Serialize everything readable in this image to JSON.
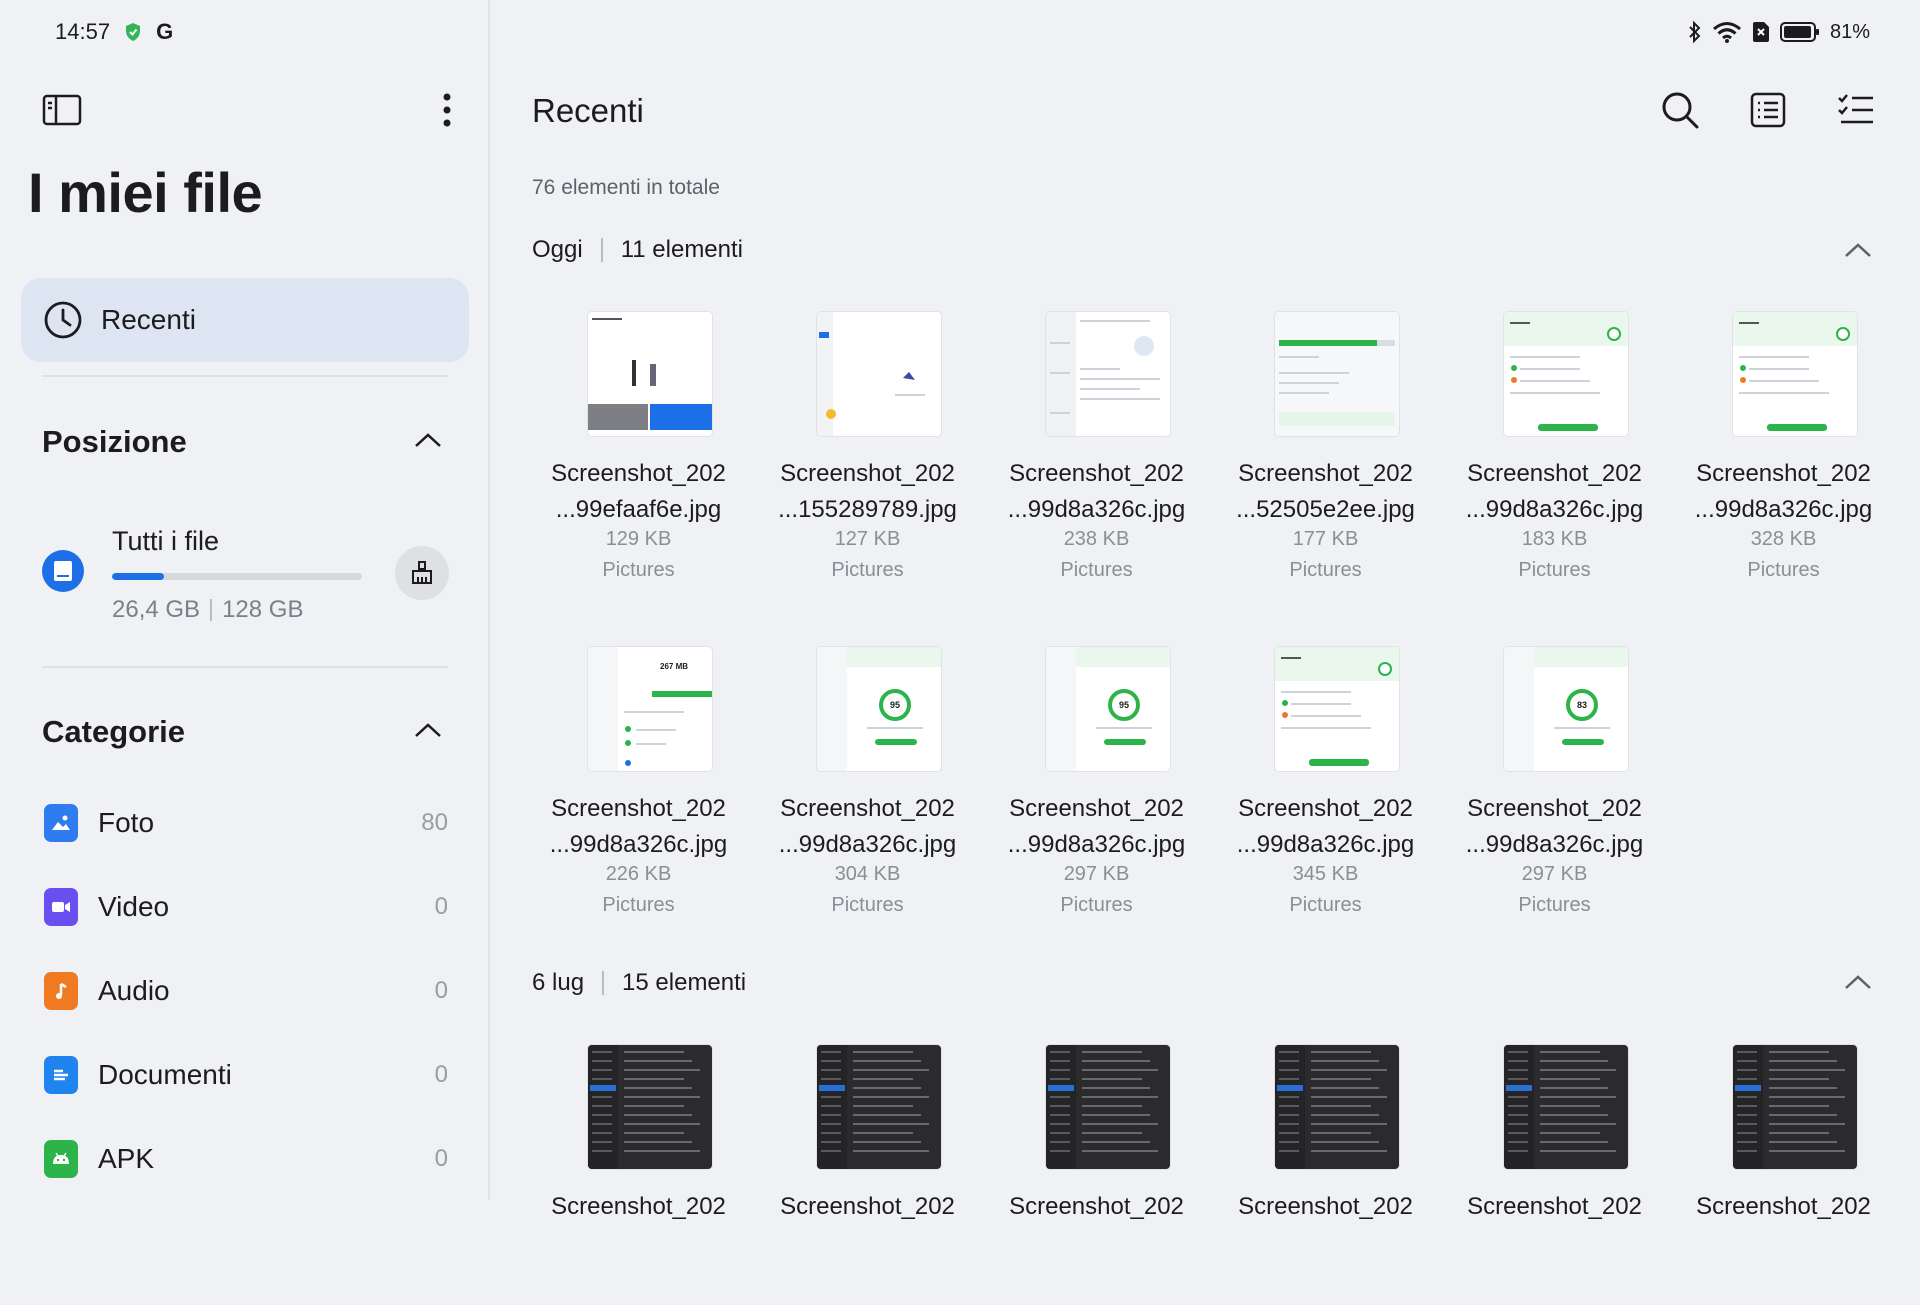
{
  "status_bar": {
    "time": "14:57",
    "left_icons": [
      "shield-icon",
      "google-icon"
    ],
    "battery_percent": "81%",
    "right_icons": [
      "bluetooth-icon",
      "wifi-icon",
      "no-sim-icon",
      "battery-icon"
    ]
  },
  "sidebar": {
    "title": "I miei file",
    "recent_label": "Recenti",
    "position_section": "Posizione",
    "storage": {
      "name": "Tutti i file",
      "used": "26,4 GB",
      "total": "128 GB",
      "used_fraction": 0.206
    },
    "categories_section": "Categorie",
    "categories": [
      {
        "label": "Foto",
        "count": "80",
        "color": "#2f7bf0",
        "icon": "image-icon"
      },
      {
        "label": "Video",
        "count": "0",
        "color": "#6a4ff0",
        "icon": "video-icon"
      },
      {
        "label": "Audio",
        "count": "0",
        "color": "#f07a22",
        "icon": "music-note-icon"
      },
      {
        "label": "Documenti",
        "count": "0",
        "color": "#1f84ee",
        "icon": "document-icon"
      },
      {
        "label": "APK",
        "count": "0",
        "color": "#2cb34a",
        "icon": "android-icon"
      }
    ]
  },
  "main": {
    "title": "Recenti",
    "total": "76 elementi in totale",
    "groups": [
      {
        "date": "Oggi",
        "count": "11 elementi",
        "files": [
          {
            "line1": "Screenshot_202",
            "line2": "...99efaaf6e.jpg",
            "size": "129 KB",
            "folder": "Pictures",
            "thumb": "clone"
          },
          {
            "line1": "Screenshot_202",
            "line2": "...155289789.jpg",
            "size": "127 KB",
            "folder": "Pictures",
            "thumb": "blank"
          },
          {
            "line1": "Screenshot_202",
            "line2": "...99d8a326c.jpg",
            "size": "238 KB",
            "folder": "Pictures",
            "thumb": "settings"
          },
          {
            "line1": "Screenshot_202",
            "line2": "...52505e2ee.jpg",
            "size": "177 KB",
            "folder": "Pictures",
            "thumb": "progress"
          },
          {
            "line1": "Screenshot_202",
            "line2": "...99d8a326c.jpg",
            "size": "183 KB",
            "folder": "Pictures",
            "thumb": "green"
          },
          {
            "line1": "Screenshot_202",
            "line2": "...99d8a326c.jpg",
            "size": "328 KB",
            "folder": "Pictures",
            "thumb": "green"
          },
          {
            "line1": "Screenshot_202",
            "line2": "...99d8a326c.jpg",
            "size": "226 KB",
            "folder": "Pictures",
            "thumb": "cleaner",
            "badge": "267 MB"
          },
          {
            "line1": "Screenshot_202",
            "line2": "...99d8a326c.jpg",
            "size": "304 KB",
            "folder": "Pictures",
            "thumb": "score",
            "score": "95"
          },
          {
            "line1": "Screenshot_202",
            "line2": "...99d8a326c.jpg",
            "size": "297 KB",
            "folder": "Pictures",
            "thumb": "score",
            "score": "95"
          },
          {
            "line1": "Screenshot_202",
            "line2": "...99d8a326c.jpg",
            "size": "345 KB",
            "folder": "Pictures",
            "thumb": "green"
          },
          {
            "line1": "Screenshot_202",
            "line2": "...99d8a326c.jpg",
            "size": "297 KB",
            "folder": "Pictures",
            "thumb": "score",
            "score": "83"
          }
        ]
      },
      {
        "date": "6 lug",
        "count": "15 elementi",
        "files": [
          {
            "line1": "Screenshot_202",
            "thumb": "dark"
          },
          {
            "line1": "Screenshot_202",
            "thumb": "dark"
          },
          {
            "line1": "Screenshot_202",
            "thumb": "dark"
          },
          {
            "line1": "Screenshot_202",
            "thumb": "dark"
          },
          {
            "line1": "Screenshot_202",
            "thumb": "dark"
          },
          {
            "line1": "Screenshot_202",
            "thumb": "dark"
          }
        ]
      }
    ]
  }
}
